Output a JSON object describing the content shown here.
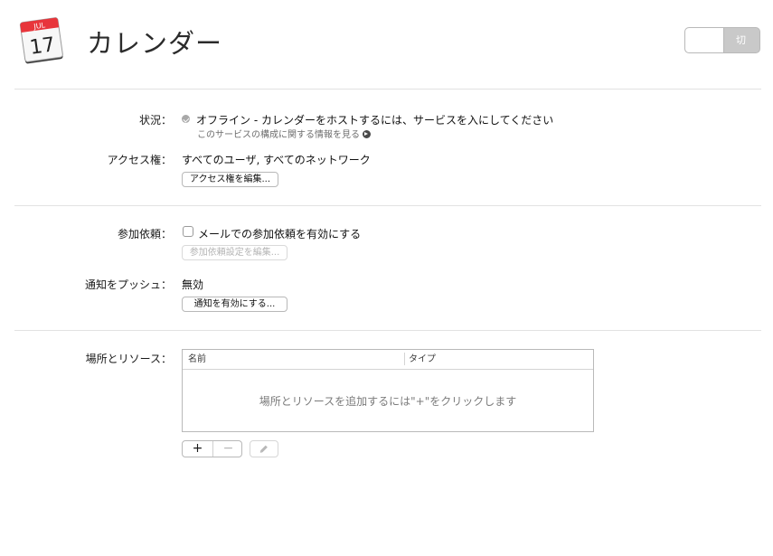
{
  "header": {
    "app_icon": {
      "name": "calendar-icon",
      "month": "JUL",
      "day": "17"
    },
    "title": "カレンダー",
    "power_switch": {
      "state_label": "切",
      "is_on": false
    }
  },
  "status": {
    "label": "状況：",
    "icon": "status-offline-icon",
    "text": "オフライン - カレンダーをホストするには、サービスを入にしてください",
    "help_link": "このサービスの構成に関する情報を見る",
    "help_link_icon": "arrow-circle-right-icon"
  },
  "access": {
    "label": "アクセス権：",
    "value": "すべてのユーザ, すべてのネットワーク",
    "edit_button": "アクセス権を編集..."
  },
  "invitations": {
    "label": "参加依頼：",
    "checkbox_label": "メールでの参加依頼を有効にする",
    "checked": false,
    "edit_button": "参加依頼設定を編集..."
  },
  "push": {
    "label": "通知をプッシュ：",
    "value": "無効",
    "enable_button": "通知を有効にする..."
  },
  "locations": {
    "label": "場所とリソース：",
    "columns": [
      "名前",
      "タイプ"
    ],
    "empty_message": "場所とリソースを追加するには\"+\"をクリックします",
    "add_label": "+",
    "remove_label": "−",
    "edit_icon": "pencil-icon"
  }
}
